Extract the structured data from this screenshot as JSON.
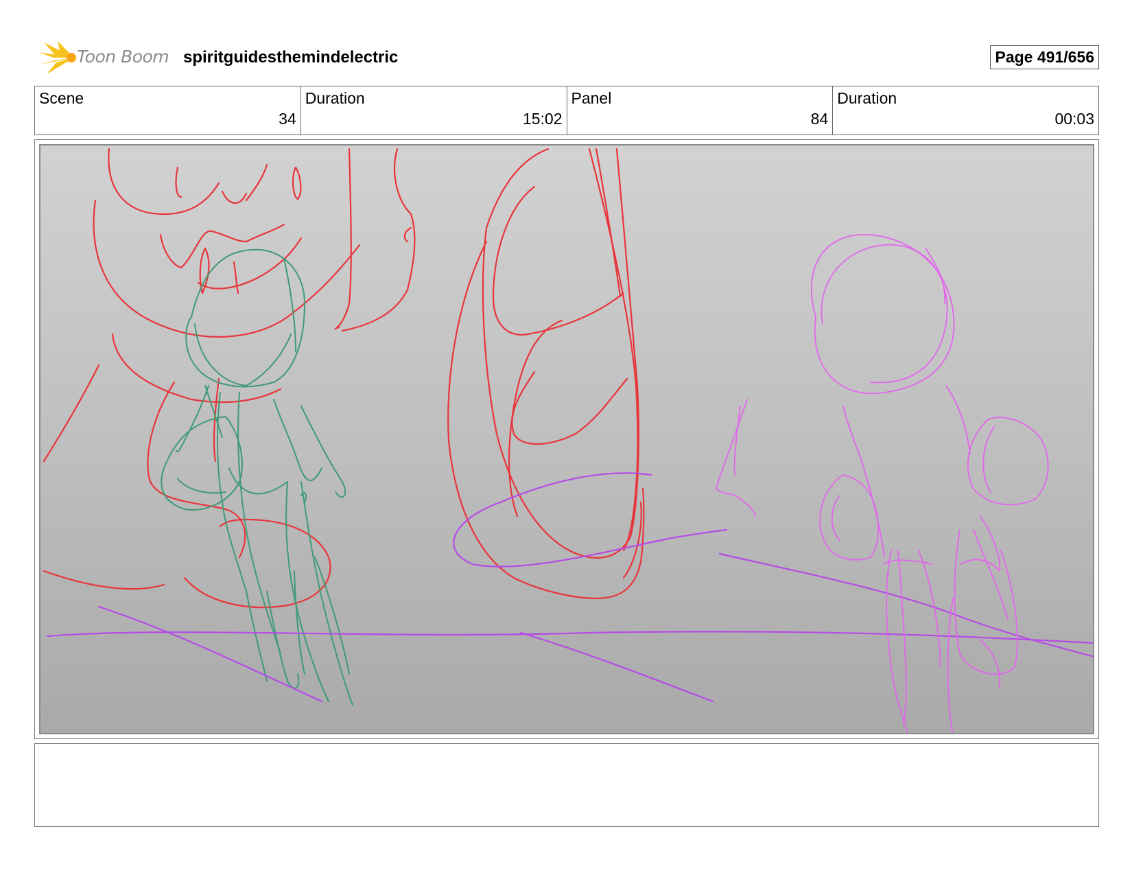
{
  "header": {
    "brand": "Toon Boom",
    "project_title": "spiritguidesthemindelectric",
    "page_indicator": "Page 491/656"
  },
  "info": {
    "scene_label": "Scene",
    "scene_value": "34",
    "scene_duration_label": "Duration",
    "scene_duration_value": "15:02",
    "panel_label": "Panel",
    "panel_value": "84",
    "panel_duration_label": "Duration",
    "panel_duration_value": "00:03"
  },
  "sketch_colors": {
    "red": "#e8353b",
    "green": "#3f9a76",
    "purple": "#b64be6",
    "pink": "#e266ec"
  },
  "notes": {
    "text": ""
  }
}
